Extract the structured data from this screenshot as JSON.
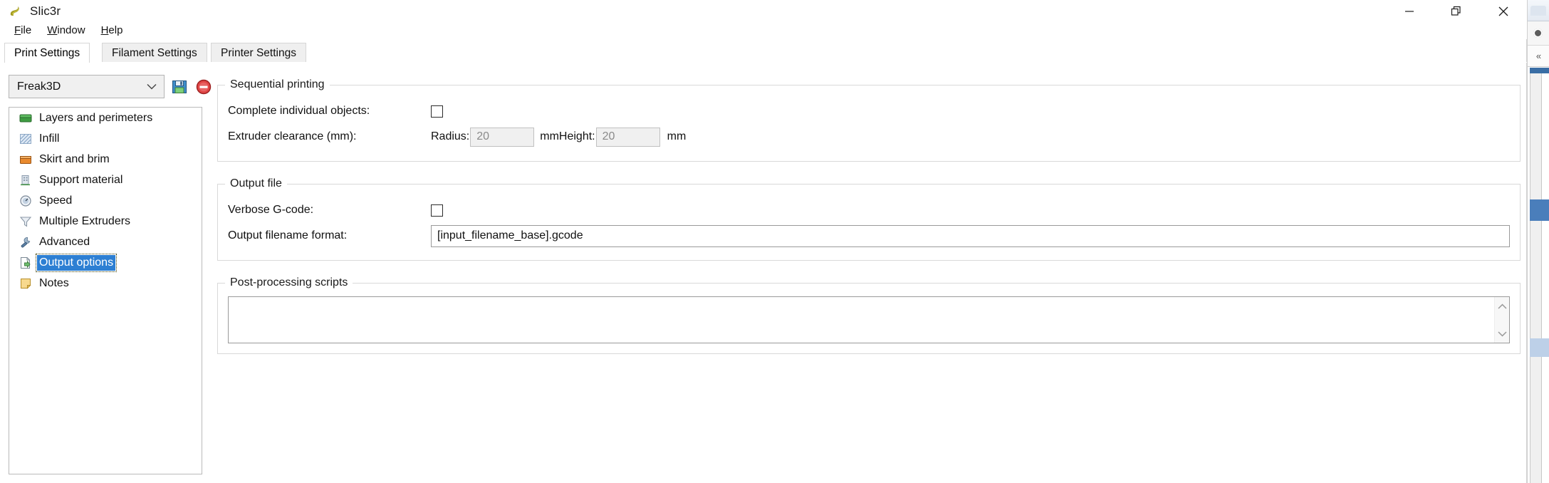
{
  "window": {
    "title": "Slic3r",
    "logo_icon": "slic3r-logo-icon",
    "controls": {
      "minimize": "minimize-icon",
      "restore": "restore-icon",
      "close": "close-icon"
    }
  },
  "menubar": {
    "items": [
      {
        "label": "File",
        "accel": "F"
      },
      {
        "label": "Window",
        "accel": "W"
      },
      {
        "label": "Help",
        "accel": "H"
      }
    ]
  },
  "tabs": [
    {
      "label": "Print Settings",
      "active": true
    },
    {
      "label": "Filament Settings",
      "active": false
    },
    {
      "label": "Printer Settings",
      "active": false
    }
  ],
  "preset": {
    "value": "Freak3D",
    "dropdown_icon": "chevron-down-icon",
    "save_icon": "save-preset-icon",
    "delete_icon": "delete-preset-icon"
  },
  "sidebar": {
    "items": [
      {
        "label": "Layers and perimeters",
        "icon": "layers-icon",
        "selected": false
      },
      {
        "label": "Infill",
        "icon": "infill-icon",
        "selected": false
      },
      {
        "label": "Skirt and brim",
        "icon": "skirt-icon",
        "selected": false
      },
      {
        "label": "Support material",
        "icon": "support-icon",
        "selected": false
      },
      {
        "label": "Speed",
        "icon": "speed-icon",
        "selected": false
      },
      {
        "label": "Multiple Extruders",
        "icon": "extruders-icon",
        "selected": false
      },
      {
        "label": "Advanced",
        "icon": "advanced-icon",
        "selected": false
      },
      {
        "label": "Output options",
        "icon": "output-options-icon",
        "selected": true
      },
      {
        "label": "Notes",
        "icon": "notes-icon",
        "selected": false
      }
    ]
  },
  "sections": {
    "sequential": {
      "legend": "Sequential printing",
      "complete_objects_label": "Complete individual objects:",
      "complete_objects_checked": false,
      "clearance_label": "Extruder clearance (mm):",
      "radius_label": "Radius:",
      "radius_value": "20",
      "radius_unit": "mm",
      "height_label": "Height:",
      "height_value": "20",
      "height_unit": "mm"
    },
    "output_file": {
      "legend": "Output file",
      "verbose_label": "Verbose G-code:",
      "verbose_checked": false,
      "filename_label": "Output filename format:",
      "filename_value": "[input_filename_base].gcode"
    },
    "post_processing": {
      "legend": "Post-processing scripts",
      "value": "",
      "scroll_up_icon": "chevron-up-icon",
      "scroll_down_icon": "chevron-down-icon"
    }
  },
  "colors": {
    "selection_blue": "#2d7fd3",
    "panel_border": "#b9b9b9",
    "group_border": "#d9d9d9",
    "disabled_field_bg": "#f0f0f0",
    "disabled_text": "#8a8a8a"
  }
}
